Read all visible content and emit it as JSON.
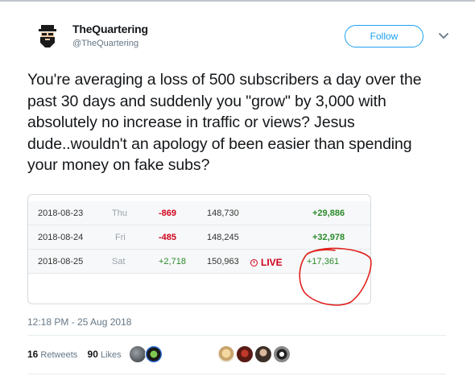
{
  "author": {
    "name": "TheQuartering",
    "handle": "@TheQuartering"
  },
  "follow_label": "Follow",
  "tweet_text": "You're averaging a loss of 500 subscribers a day over the past 30 days and suddenly you \"grow\" by 3,000 with absolutely no increase in traffic or views?  Jesus dude..wouldn't an apology of been easier than spending your money on fake subs?",
  "stats_table": {
    "rows": [
      {
        "date": "2018-08-23",
        "day": "Thu",
        "change": "-869",
        "total": "148,730",
        "views": "+29,886"
      },
      {
        "date": "2018-08-24",
        "day": "Fri",
        "change": "-485",
        "total": "148,245",
        "views": "+32,978"
      },
      {
        "date": "2018-08-25",
        "day": "Sat",
        "change": "+2,718",
        "total": "150,963",
        "live": "LIVE",
        "views": "+17,361"
      }
    ]
  },
  "timestamp": "12:18 PM - 25 Aug 2018",
  "engagement": {
    "retweets_count": "16",
    "retweets_label": "Retweets",
    "likes_count": "90",
    "likes_label": "Likes"
  },
  "colors": {
    "accent": "#1da1f2",
    "negative": "#d0021b",
    "positive": "#2a8a2a",
    "annotation": "#e0201c"
  }
}
